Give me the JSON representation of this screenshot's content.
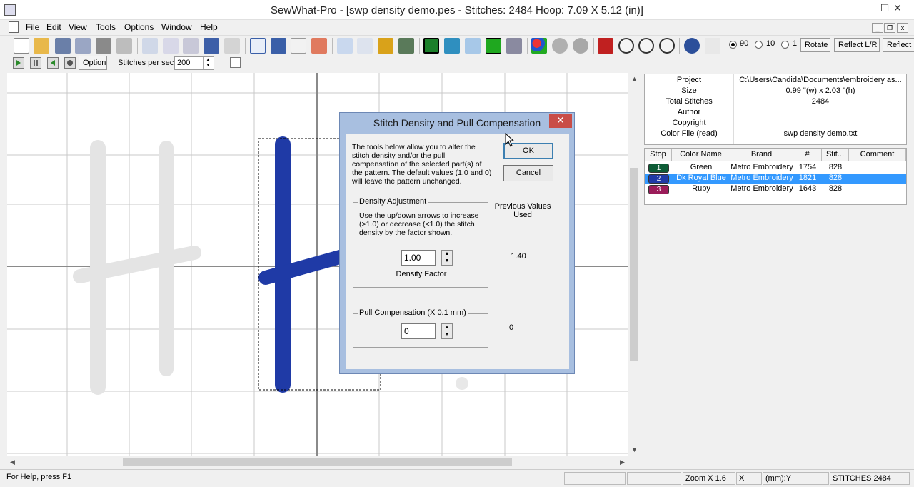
{
  "window": {
    "title": "SewWhat-Pro - [swp density demo.pes - Stitches: 2484  Hoop: 7.09 X 5.12 (in)]",
    "min": "—",
    "max": "☐",
    "close": "✕"
  },
  "menu": [
    "File",
    "Edit",
    "View",
    "Tools",
    "Options",
    "Window",
    "Help"
  ],
  "mdi": {
    "min": "_",
    "restore": "❐",
    "close": "x"
  },
  "toolbar": {
    "radio_90": "90",
    "radio_10": "10",
    "radio_1": "1",
    "rotate": "Rotate",
    "reflect_lr": "Reflect L/R",
    "reflect": "Reflect"
  },
  "toolbar2": {
    "options": "Options",
    "stitches_label": "Stitches per sec",
    "stitches_value": "200"
  },
  "info": [
    {
      "key": "Project",
      "value": "C:\\Users\\Candida\\Documents\\embroidery as..."
    },
    {
      "key": "Size",
      "value": "0.99 \"(w) x 2.03 \"(h)"
    },
    {
      "key": "Total Stitches",
      "value": "2484"
    },
    {
      "key": "Author",
      "value": ""
    },
    {
      "key": "Copyright",
      "value": ""
    },
    {
      "key": "Color File (read)",
      "value": "swp density demo.txt"
    }
  ],
  "colors": {
    "headers": [
      "Stop",
      "Color Name",
      "Brand",
      "#",
      "Stit...",
      "Comment"
    ],
    "rows": [
      {
        "stop": "1",
        "name": "Green",
        "brand": "Metro Embroidery",
        "num": "1754",
        "stit": "828",
        "comment": "",
        "swatch": "#0d5c36"
      },
      {
        "stop": "2",
        "name": "Dk Royal Blue",
        "brand": "Metro Embroidery",
        "num": "1821",
        "stit": "828",
        "comment": "",
        "swatch": "#1f3aa6"
      },
      {
        "stop": "3",
        "name": "Ruby",
        "brand": "Metro Embroidery",
        "num": "1643",
        "stit": "828",
        "comment": "",
        "swatch": "#9b1c5a"
      }
    ]
  },
  "status": {
    "help": "For Help, press F1",
    "zoom": "Zoom X 1.6",
    "x": "X",
    "mmy": "(mm):Y",
    "stitches": "STITCHES  2484"
  },
  "dialog": {
    "title": "Stitch Density and Pull Compensation",
    "close": "✕",
    "intro": "The tools below allow you to alter the stitch density and/or the pull compensation of the selected part(s) of the pattern. The default values (1.0 and 0) will leave the pattern unchanged.",
    "ok": "OK",
    "cancel": "Cancel",
    "prev_label": "Previous Values Used",
    "density_group": "Density Adjustment",
    "density_help": "Use the up/down arrows to increase (>1.0) or decrease (<1.0)  the stitch density by the factor shown.",
    "density_value": "1.00",
    "density_label": "Density Factor",
    "density_prev": "1.40",
    "pull_group": "Pull Compensation (X 0.1 mm)",
    "pull_value": "0",
    "pull_prev": "0"
  },
  "colors_ui": {
    "thread_blue": "#1f3aa6",
    "thread_white": "#e6e6e6",
    "select": "#3399ff",
    "dialog_frame": "#a8bfe0"
  }
}
